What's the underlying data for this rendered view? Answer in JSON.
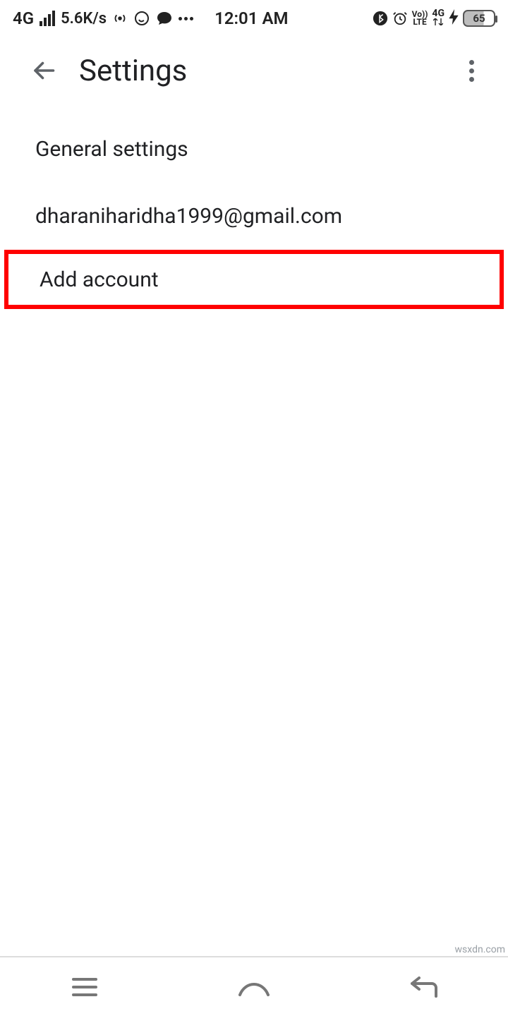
{
  "status": {
    "network_label": "4G",
    "net_speed": "5.6K/s",
    "time": "12:01 AM",
    "volte_top": "Vo))",
    "volte_bottom": "LTE",
    "sig2_label": "4G",
    "battery_pct": "65"
  },
  "appbar": {
    "title": "Settings"
  },
  "list": {
    "general": "General settings",
    "account": "dharaniharidha1999@gmail.com",
    "add_account": "Add account"
  },
  "watermark": "wsxdn.com"
}
